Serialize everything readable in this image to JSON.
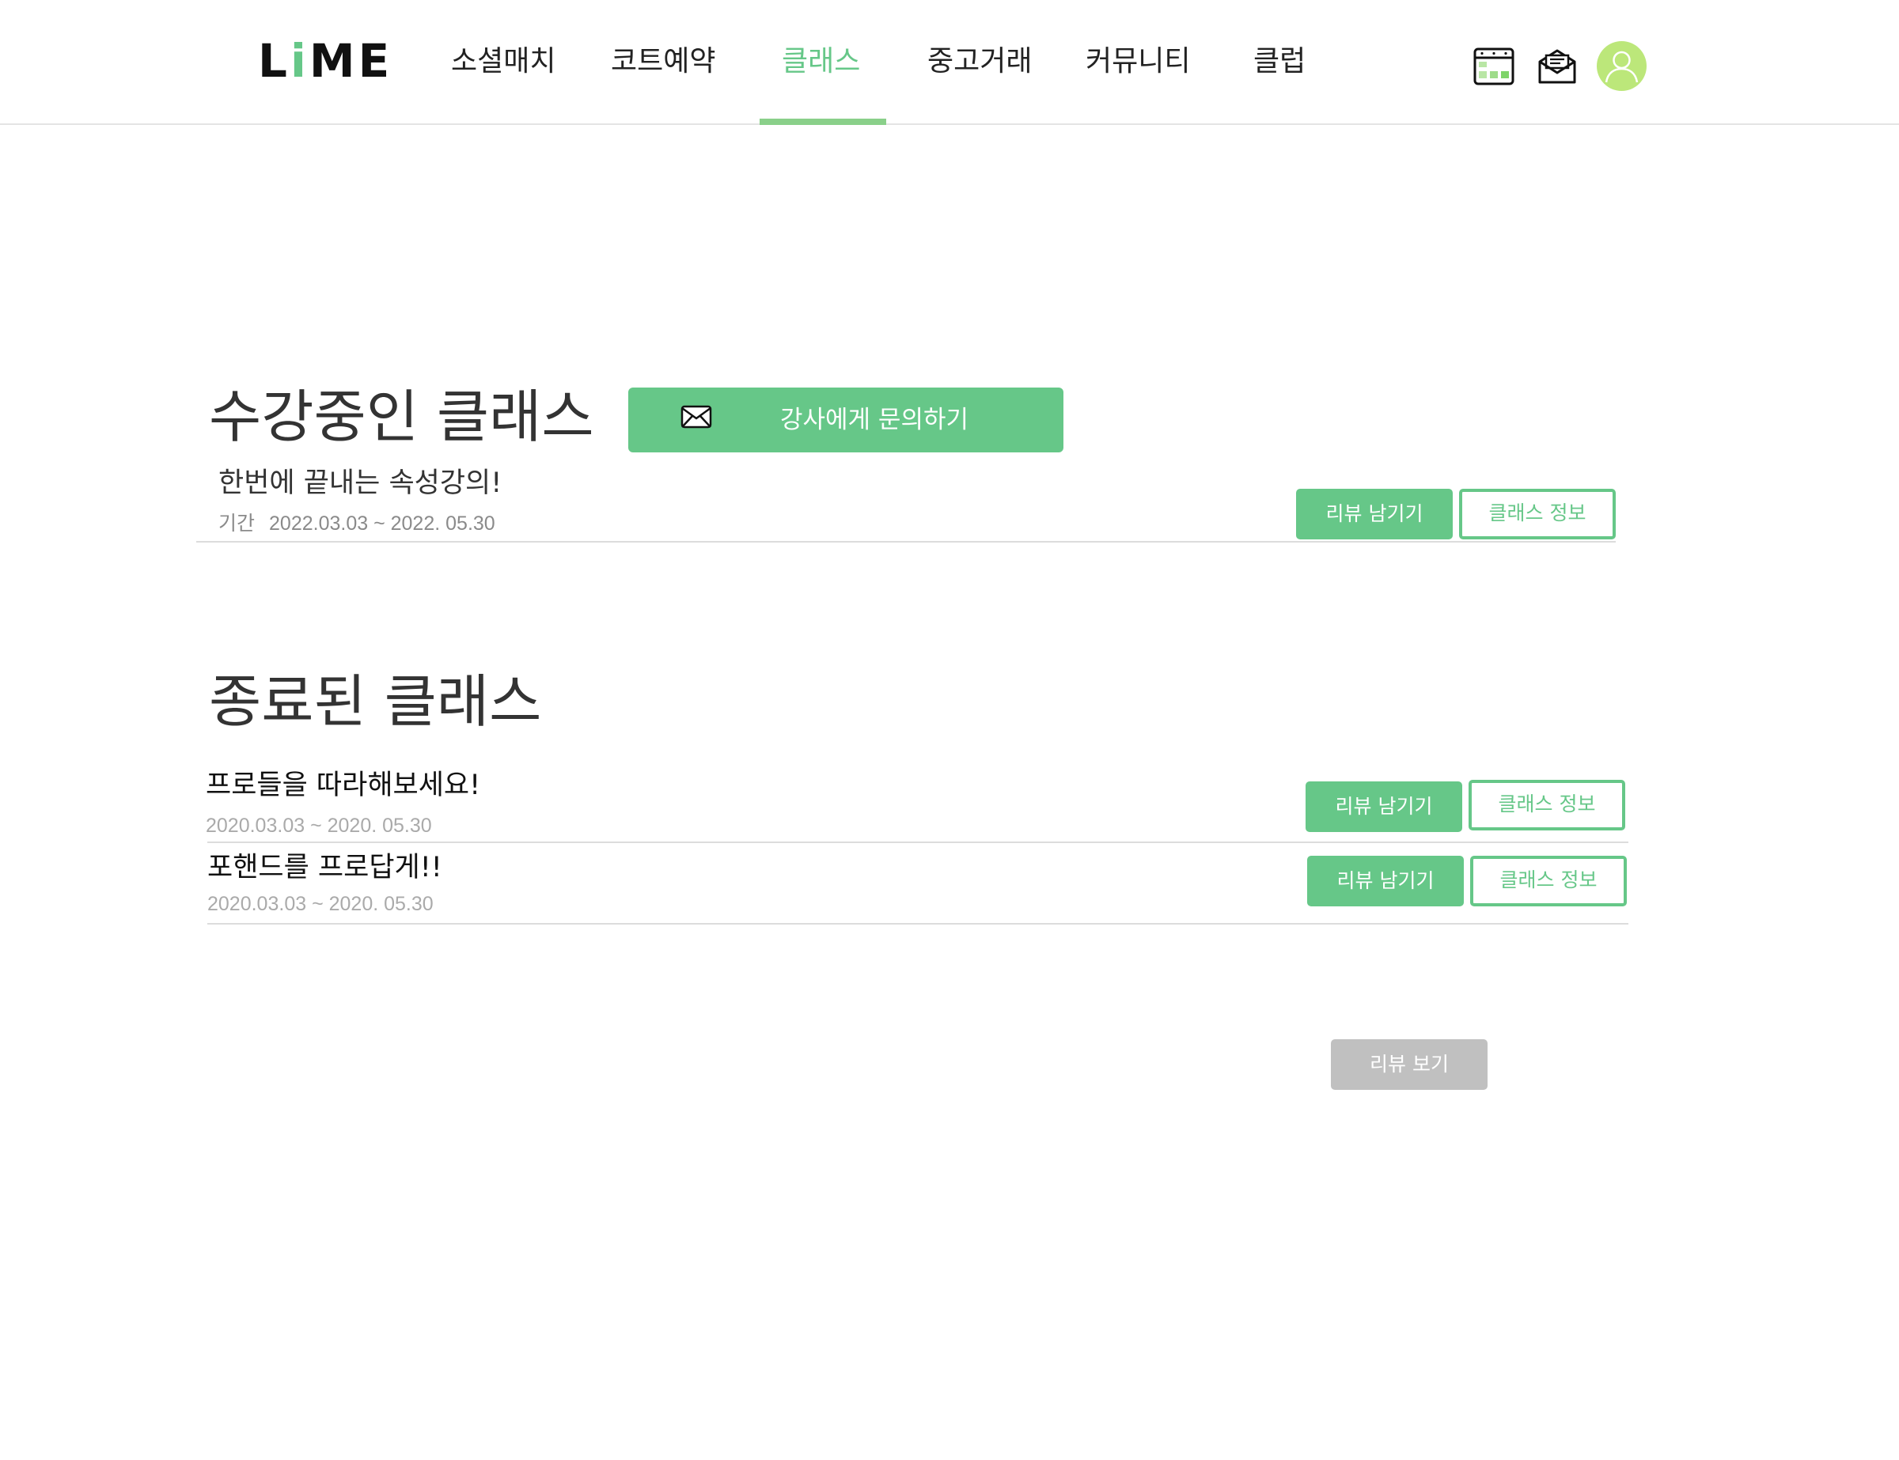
{
  "header": {
    "logo": {
      "prefix": "L",
      "accent": "i",
      "suffix": "ME"
    },
    "nav": [
      {
        "label": "소셜매치"
      },
      {
        "label": "코트예약"
      },
      {
        "label": "클래스"
      },
      {
        "label": "중고거래"
      },
      {
        "label": "커뮤니티"
      },
      {
        "label": "클럽"
      }
    ],
    "active_nav": "클래스",
    "icons": [
      "calendar-icon",
      "mail-icon",
      "avatar-user-icon"
    ]
  },
  "current": {
    "title": "수강중인 클래스",
    "inquiry_button": "강사에게 문의하기",
    "items": [
      {
        "title": "한번에 끝내는 속성강의!",
        "period_label": "기간",
        "period": "2022.03.03 ~ 2022. 05.30",
        "review_button": "리뷰 남기기",
        "info_button": "클래스 정보"
      }
    ]
  },
  "finished": {
    "title": "종료된 클래스",
    "items": [
      {
        "title": "프로들을 따라해보세요!",
        "period": "2020.03.03 ~ 2020. 05.30",
        "review_button": "리뷰 남기기",
        "info_button": "클래스 정보"
      },
      {
        "title": "포핸드를 프로답게!!",
        "period": "2020.03.03 ~ 2020. 05.30",
        "review_button": "리뷰 남기기",
        "info_button": "클래스 정보"
      }
    ]
  },
  "view_reviews_button": "리뷰 보기",
  "colors": {
    "accent": "#66c788",
    "nav_underline": "#8ad08a",
    "avatar_bg": "#bce77a",
    "disabled": "#c0c0c0",
    "muted_text": "#aaaaaa"
  }
}
